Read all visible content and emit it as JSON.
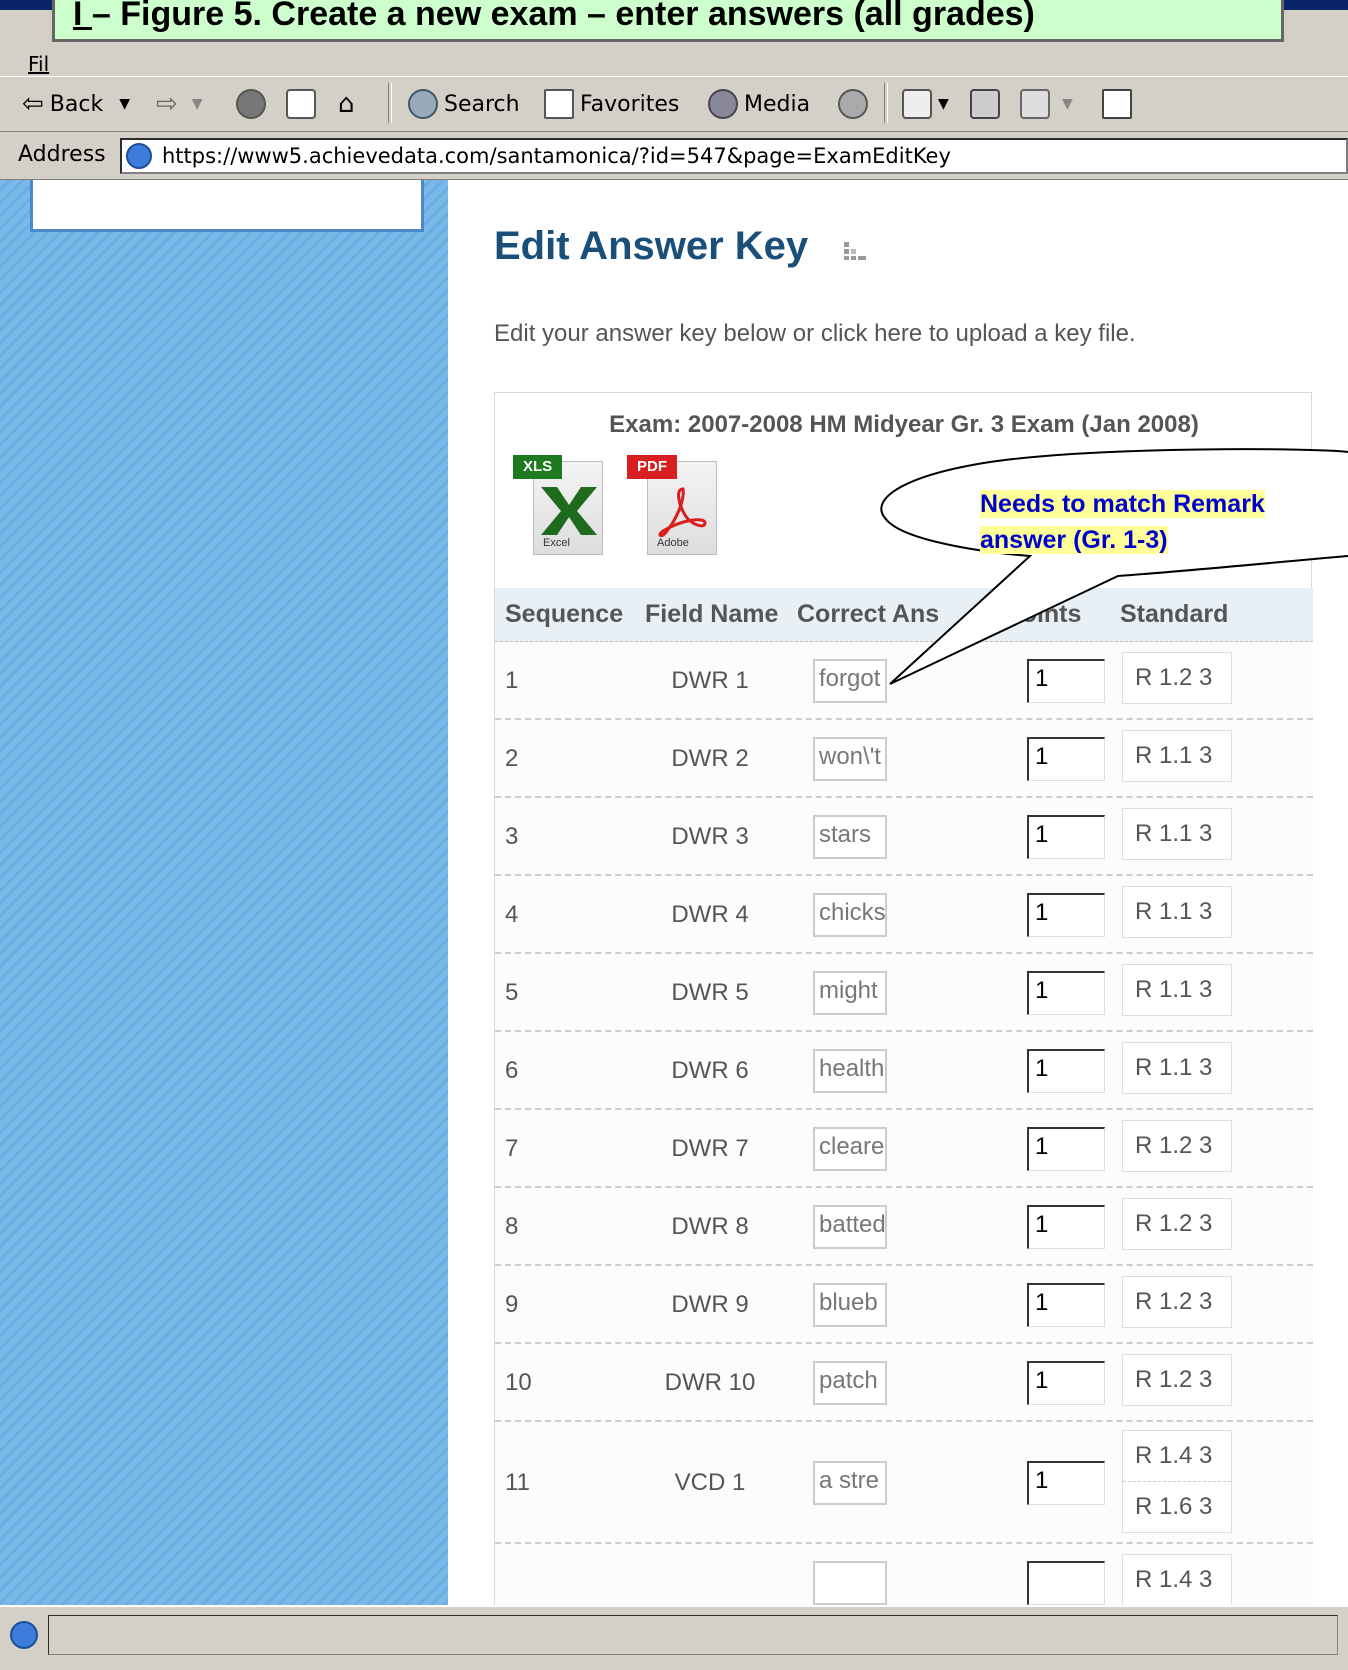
{
  "caption": {
    "prefix": "I ",
    "text": "– Figure 5. Create a new exam – enter answers (all grades)"
  },
  "menubar": {
    "file": "Fil"
  },
  "toolbar": {
    "back": "Back",
    "search": "Search",
    "favorites": "Favorites",
    "media": "Media"
  },
  "address": {
    "label": "Address",
    "url": "https://www5.achievedata.com/santamonica/?id=547&page=ExamEditKey"
  },
  "page": {
    "title": "Edit Answer Key",
    "intro": "Edit your answer key below or click here to upload a key file.",
    "exam_title": "Exam: 2007-2008 HM Midyear Gr. 3 Exam (Jan 2008)",
    "xls": {
      "tag": "XLS",
      "sub": "Excel"
    },
    "pdf": {
      "tag": "PDF",
      "sub": "Adobe"
    },
    "headers": {
      "sequence": "Sequence",
      "field_name": "Field Name",
      "correct_answer": "Correct Ans",
      "points": "Points",
      "standard": "Standard"
    },
    "rows": [
      {
        "seq": "1",
        "field": "DWR 1",
        "answer": "forgot",
        "points": "1",
        "standards": [
          "R 1.2 3"
        ]
      },
      {
        "seq": "2",
        "field": "DWR 2",
        "answer": "won\\'t",
        "points": "1",
        "standards": [
          "R 1.1 3"
        ]
      },
      {
        "seq": "3",
        "field": "DWR 3",
        "answer": "stars",
        "points": "1",
        "standards": [
          "R 1.1 3"
        ]
      },
      {
        "seq": "4",
        "field": "DWR 4",
        "answer": "chicks",
        "points": "1",
        "standards": [
          "R 1.1 3"
        ]
      },
      {
        "seq": "5",
        "field": "DWR 5",
        "answer": "might",
        "points": "1",
        "standards": [
          "R 1.1 3"
        ]
      },
      {
        "seq": "6",
        "field": "DWR 6",
        "answer": "health",
        "points": "1",
        "standards": [
          "R 1.1 3"
        ]
      },
      {
        "seq": "7",
        "field": "DWR 7",
        "answer": "cleared",
        "points": "1",
        "standards": [
          "R 1.2 3"
        ]
      },
      {
        "seq": "8",
        "field": "DWR 8",
        "answer": "batted",
        "points": "1",
        "standards": [
          "R 1.2 3"
        ]
      },
      {
        "seq": "9",
        "field": "DWR 9",
        "answer": "blueb",
        "points": "1",
        "standards": [
          "R 1.2 3"
        ]
      },
      {
        "seq": "10",
        "field": "DWR 10",
        "answer": "patch",
        "points": "1",
        "standards": [
          "R 1.2 3"
        ]
      },
      {
        "seq": "11",
        "field": "VCD 1",
        "answer": "a stre",
        "points": "1",
        "standards": [
          "R 1.4 3",
          "R 1.6 3"
        ]
      },
      {
        "seq": "",
        "field": "",
        "answer": "",
        "points": "",
        "standards": [
          "R 1.4 3"
        ]
      }
    ]
  },
  "callout": {
    "line1": "Needs to match Remark",
    "line2": "answer (Gr. 1-3)"
  },
  "colors": {
    "title": "#1a4f7a",
    "callout_text": "#0000cc",
    "callout_bg": "#ffff99",
    "caption_bg": "#ccffcc",
    "sidebar": "#7ab8e8"
  }
}
